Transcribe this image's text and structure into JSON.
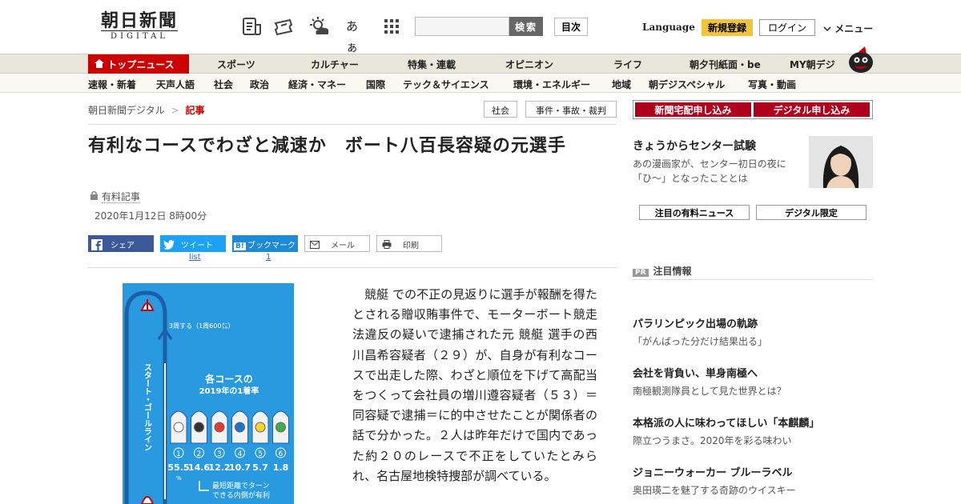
{
  "header": {
    "logo_main": "朝日新聞",
    "logo_sub": "DIGITAL",
    "search_button": "検索",
    "search_placeholder": "",
    "index_button": "目次",
    "language": "Language",
    "register": "新規登録",
    "login": "ログイン",
    "menu": "メニュー",
    "icons": [
      "newspaper-list-icon",
      "ticket-icon",
      "weather-icon",
      "font-size-icon",
      "grid-menu-icon"
    ],
    "font_size_glyph": "あぁ"
  },
  "nav_primary": {
    "active": "トップニュース",
    "items": [
      "スポーツ",
      "カルチャー",
      "特集・連載",
      "オピニオン",
      "ライフ",
      "朝夕刊紙面・be",
      "MY朝デジ"
    ]
  },
  "nav_secondary": {
    "items": [
      "速報・新着",
      "天声人語",
      "社会",
      "政治",
      "経済・マネー",
      "国際",
      "テック＆サイエンス",
      "環境・エネルギー",
      "地域",
      "朝デジスペシャル",
      "写真・動画"
    ]
  },
  "breadcrumb": {
    "home": "朝日新聞デジタル",
    "separator": ">",
    "current": "記事"
  },
  "tags": [
    "社会",
    "事件・事故・裁判"
  ],
  "article": {
    "title": "有利なコースでわざと減速か　ボート八百長容疑の元選手",
    "paid": "有料記事",
    "timestamp": "2020年1月12日 8時00分",
    "share": {
      "facebook": "シェア",
      "twitter": "ツイート",
      "twitter_count": "list",
      "hatena": "ブックマーク",
      "hatena_count": "1",
      "mail": "メール",
      "print": "印刷"
    },
    "body": "競艇 での不正の見返りに選手が報酬を得たとされる贈収賄事件で、モーターボート競走法違反の疑いで逮捕された元 競艇 選手の西川昌希容疑者（２９）が、自身が有利なコースで出走した際、わざと順位を下げて高配当をつくって会社員の増川遵容疑者（５３）＝同容疑で逮捕＝に的中させたことが関係者の話で分かった。２人は昨年だけで国内であった約２０のレースで不正をしていたとみられ、名古屋地検特捜部が調べている。"
  },
  "figure": {
    "laps_label": "3周する（1周600㍍）",
    "start_line": "スタート・ゴールライン",
    "chart_title": [
      "各コースの",
      "2019年の1着率"
    ],
    "lanes": [
      "1",
      "2",
      "3",
      "4",
      "5",
      "6"
    ],
    "rates": [
      "55.5",
      "14.6",
      "12.2",
      "10.7",
      "5.7",
      "1.8"
    ],
    "unit": "%",
    "note": [
      "最短距離でターン",
      "できる内側が有利"
    ],
    "lane_colors": [
      "#ffffff",
      "#333333",
      "#e53935",
      "#1e73c8",
      "#f5d327",
      "#3fae49"
    ]
  },
  "sidebar": {
    "subscribe": [
      "新聞宅配申し込み",
      "デジタル申し込み"
    ],
    "feature": {
      "title": "きょうからセンター試験",
      "desc": "あの漫画家が、センター初日の夜に「ひ～」となったこととは"
    },
    "buttons": [
      "注目の有料ニュース",
      "デジタル限定"
    ],
    "pr_badge": "PR",
    "pr_heading": "注目情報",
    "pr_items": [
      {
        "title": "パラリンピック出場の軌跡",
        "desc": "「がんばった分だけ結果出る」"
      },
      {
        "title": "会社を背負い、単身南極へ",
        "desc": "南極観測隊員として見た世界とは？"
      },
      {
        "title": "本格派の人に味わってほしい「本麒麟」",
        "desc": "際立つうまさ。2020年を彩る味わい"
      },
      {
        "title": "ジョニーウォーカー ブルーラベル",
        "desc": "奥田瑛二を魅了する奇跡のウイスキー"
      }
    ]
  },
  "colors": {
    "brand_red": "#c00",
    "register_yellow": "#f3c339",
    "nav_bg": "#e9e6dc",
    "figure_blue": "#2a9ae0"
  }
}
